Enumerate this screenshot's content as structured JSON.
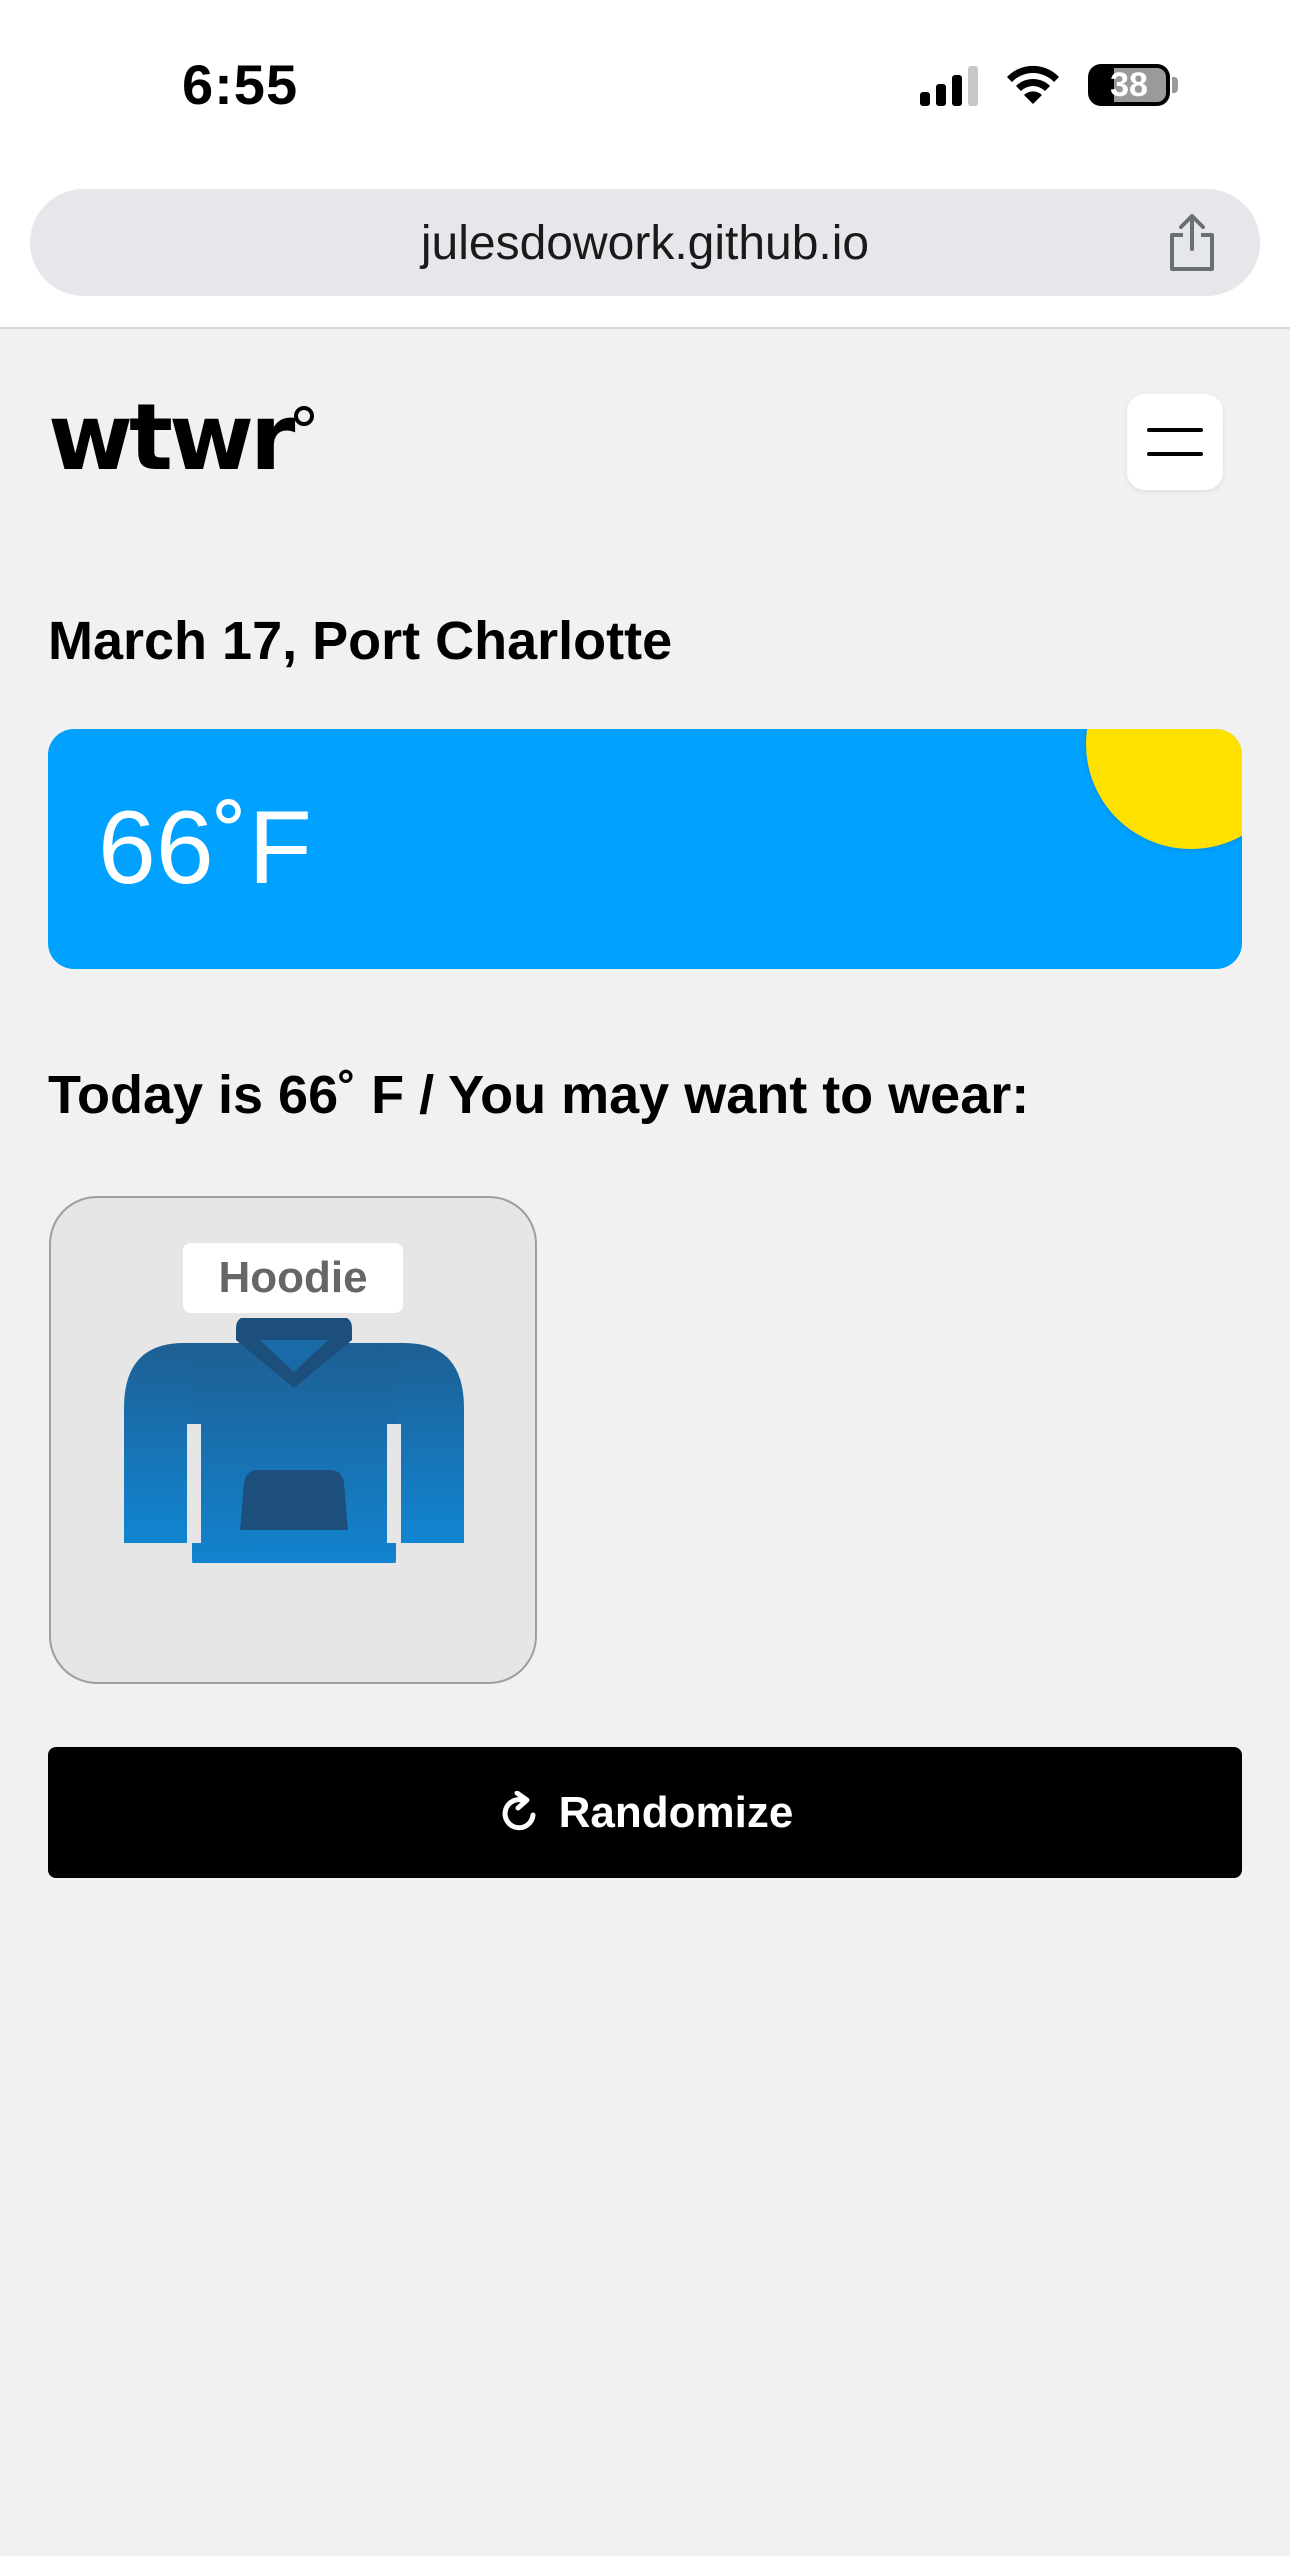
{
  "status_bar": {
    "time": "6:55",
    "battery_level": "38",
    "icons": [
      "cellular-signal-icon",
      "wifi-icon",
      "battery-icon"
    ]
  },
  "browser": {
    "url": "julesdowork.github.io",
    "share_icon": "share-icon"
  },
  "header": {
    "logo": "wtwr",
    "menu_icon": "hamburger-menu-icon"
  },
  "main": {
    "date_location": "March 17, Port Charlotte",
    "weather": {
      "temperature": "66˚F",
      "card_color": "#00a1ff",
      "sun_color": "#ffe100"
    },
    "recommendation": "Today is 66˚ F / You may want to wear:",
    "items": [
      {
        "name": "Hoodie",
        "icon": "hoodie-icon"
      }
    ],
    "randomize_label": "Randomize",
    "randomize_icon": "refresh-icon"
  }
}
